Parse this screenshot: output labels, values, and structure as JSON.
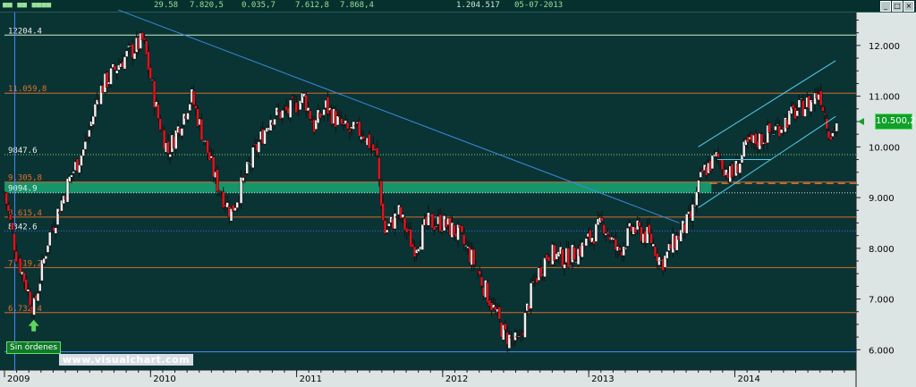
{
  "header": {
    "fields": [
      "29.58",
      "7.820,5",
      "0.035,7",
      "7.612,8",
      "7.868,4",
      "1.204.517",
      "05-07-2013"
    ],
    "colors": [
      "#9adf9a",
      "#9adf9a",
      "#9adf9a",
      "#9adf9a",
      "#9adf9a",
      "#cfe8cf",
      "#9adf9a"
    ],
    "win_buttons": [
      "_",
      "□",
      "×"
    ]
  },
  "badges": {
    "sin_ordenes": "Sin órdenes",
    "watermark": "www.visualchart.com",
    "last_price": "10.500,2"
  },
  "chart_data": {
    "type": "candlestick",
    "title": "",
    "xlabel": "",
    "ylabel": "",
    "ylim": [
      5600,
      12650
    ],
    "xlim": [
      2009.0,
      2014.83
    ],
    "y_ticks": [
      6000,
      7000,
      8000,
      9000,
      10000,
      11000,
      12000
    ],
    "y_tick_labels": [
      "6.000",
      "7.000",
      "8.000",
      "9.000",
      "10.000",
      "11.000",
      "12.000"
    ],
    "x_ticks": [
      2009,
      2010,
      2011,
      2012,
      2013,
      2014
    ],
    "x_tick_labels": [
      "2009",
      "2010",
      "2011",
      "2012",
      "2013",
      "2014"
    ],
    "grid": false,
    "hlines": [
      {
        "value": 12204.4,
        "label": "12204.4",
        "color": "#dddddd",
        "label_color": "#f0f0f0",
        "style": "solid"
      },
      {
        "value": 12200,
        "label": "",
        "color": "#88dd66",
        "label_color": "",
        "style": "dotted"
      },
      {
        "value": 11059.8,
        "label": "11.059,8",
        "color": "#d96a2a",
        "label_color": "#e07030",
        "style": "solid"
      },
      {
        "value": 9847.6,
        "label": "9847.6",
        "color": "#88dd66",
        "label_color": "#f0f0f0",
        "style": "dotted"
      },
      {
        "value": 9305.8,
        "label": "9.305,8",
        "color": "#d96a2a",
        "label_color": "#e07030",
        "style": "solid"
      },
      {
        "value": 9094.9,
        "label": "9094.9",
        "color": "#dddddd",
        "label_color": "#f0f0f0",
        "style": "dotted"
      },
      {
        "value": 8615.4,
        "label": "8.615,4",
        "color": "#d96a2a",
        "label_color": "#e07030",
        "style": "solid"
      },
      {
        "value": 8342.6,
        "label": "8342.6",
        "color": "#3a6aff",
        "label_color": "#f0f0f0",
        "style": "dotted"
      },
      {
        "value": 7619.2,
        "label": "7.619,2",
        "color": "#d96a2a",
        "label_color": "#e07030",
        "style": "solid"
      },
      {
        "value": 6732.4,
        "label": "6.732,4",
        "color": "#d96a2a",
        "label_color": "#e07030",
        "style": "solid"
      },
      {
        "value": 5960,
        "label": "",
        "color": "#4a8aff",
        "label_color": "",
        "style": "solid"
      }
    ],
    "band": {
      "from": 9094.9,
      "to": 9305.8,
      "color": "#17a070"
    },
    "trendlines": [
      {
        "x1": 2009.78,
        "y1": 12700,
        "x2": 2013.62,
        "y2": 8500,
        "color": "#3a8ae0"
      },
      {
        "x1": 2013.75,
        "y1": 10000,
        "x2": 2014.69,
        "y2": 11700,
        "color": "#55ccee"
      },
      {
        "x1": 2013.75,
        "y1": 8800,
        "x2": 2014.69,
        "y2": 10600,
        "color": "#55ccee"
      },
      {
        "x1": 2013.88,
        "y1": 9750,
        "x2": 2014.25,
        "y2": 9750,
        "color": "#55ccee"
      }
    ],
    "dashed_line": {
      "value": 9280,
      "from_x": 2013.83,
      "color": "#ff8a3a"
    },
    "vertical_marker": {
      "x": 2009.07,
      "color": "#4a8aff"
    },
    "signal_arrow": {
      "x": 2009.2,
      "value": 6450,
      "color": "#5fd35f"
    },
    "last_price": 10500.2,
    "anchors": [
      [
        2009.0,
        9100
      ],
      [
        2009.08,
        7900
      ],
      [
        2009.2,
        6800
      ],
      [
        2009.3,
        8200
      ],
      [
        2009.45,
        9400
      ],
      [
        2009.55,
        10000
      ],
      [
        2009.65,
        11100
      ],
      [
        2009.8,
        11700
      ],
      [
        2009.95,
        12100
      ],
      [
        2010.05,
        10600
      ],
      [
        2010.12,
        9900
      ],
      [
        2010.28,
        11000
      ],
      [
        2010.45,
        9300
      ],
      [
        2010.55,
        8700
      ],
      [
        2010.7,
        9800
      ],
      [
        2010.82,
        10600
      ],
      [
        2010.95,
        10700
      ],
      [
        2011.05,
        11000
      ],
      [
        2011.12,
        10400
      ],
      [
        2011.2,
        10800
      ],
      [
        2011.28,
        10500
      ],
      [
        2011.35,
        10300
      ],
      [
        2011.45,
        10300
      ],
      [
        2011.55,
        9800
      ],
      [
        2011.6,
        8300
      ],
      [
        2011.7,
        8700
      ],
      [
        2011.8,
        8000
      ],
      [
        2011.9,
        8500
      ],
      [
        2012.0,
        8500
      ],
      [
        2012.1,
        8300
      ],
      [
        2012.2,
        7800
      ],
      [
        2012.32,
        7000
      ],
      [
        2012.42,
        6300
      ],
      [
        2012.52,
        6100
      ],
      [
        2012.62,
        7300
      ],
      [
        2012.72,
        7900
      ],
      [
        2012.85,
        7800
      ],
      [
        2012.95,
        8000
      ],
      [
        2013.1,
        8500
      ],
      [
        2013.2,
        7900
      ],
      [
        2013.3,
        8400
      ],
      [
        2013.42,
        8200
      ],
      [
        2013.5,
        7700
      ],
      [
        2013.58,
        8100
      ],
      [
        2013.7,
        8600
      ],
      [
        2013.78,
        9500
      ],
      [
        2013.88,
        9800
      ],
      [
        2013.98,
        9400
      ],
      [
        2014.08,
        10000
      ],
      [
        2014.2,
        10200
      ],
      [
        2014.3,
        10400
      ],
      [
        2014.42,
        10700
      ],
      [
        2014.52,
        10900
      ],
      [
        2014.58,
        11100
      ],
      [
        2014.62,
        10600
      ],
      [
        2014.66,
        10200
      ],
      [
        2014.7,
        10500
      ]
    ]
  }
}
